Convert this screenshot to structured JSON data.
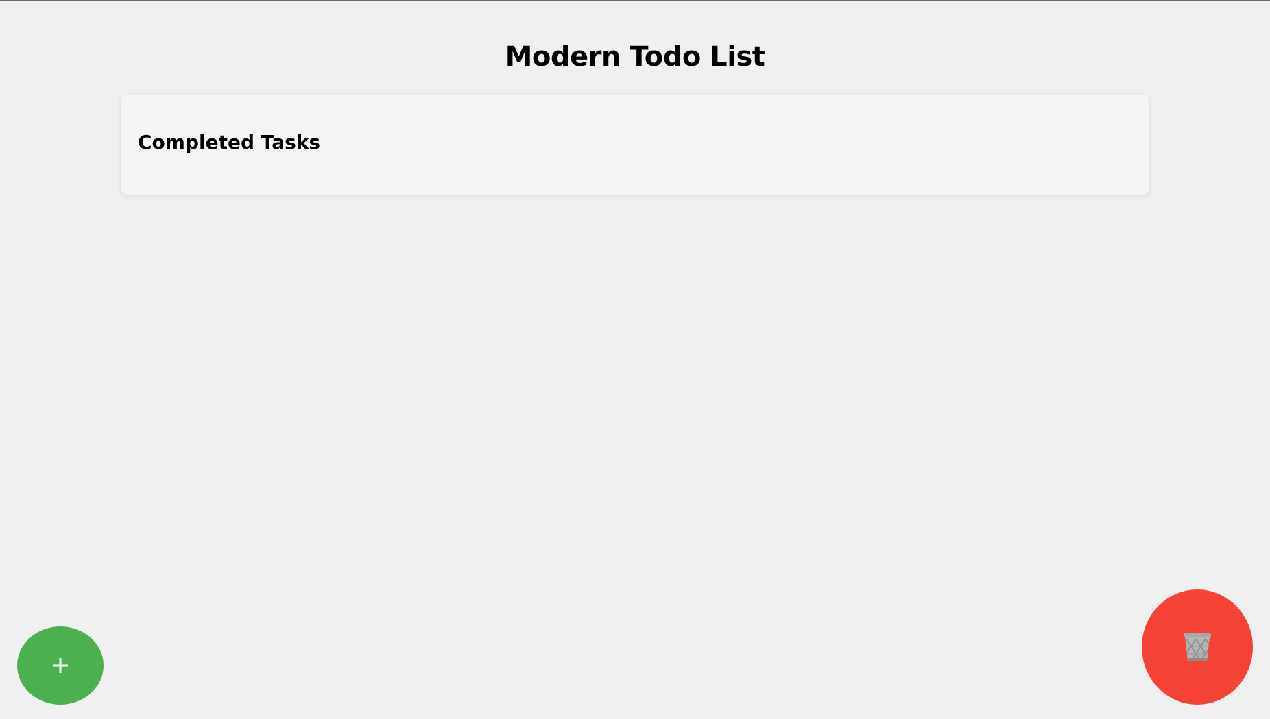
{
  "page": {
    "title": "Modern Todo List"
  },
  "completed_section": {
    "heading": "Completed Tasks",
    "items": []
  },
  "actions": {
    "add_button": {
      "icon": "plus-icon",
      "color": "#4caf50"
    },
    "delete_button": {
      "icon": "trash-icon",
      "color": "#f44336"
    }
  },
  "colors": {
    "background": "#f0f0f0",
    "card": "#f5f5f5",
    "text": "#000000"
  }
}
